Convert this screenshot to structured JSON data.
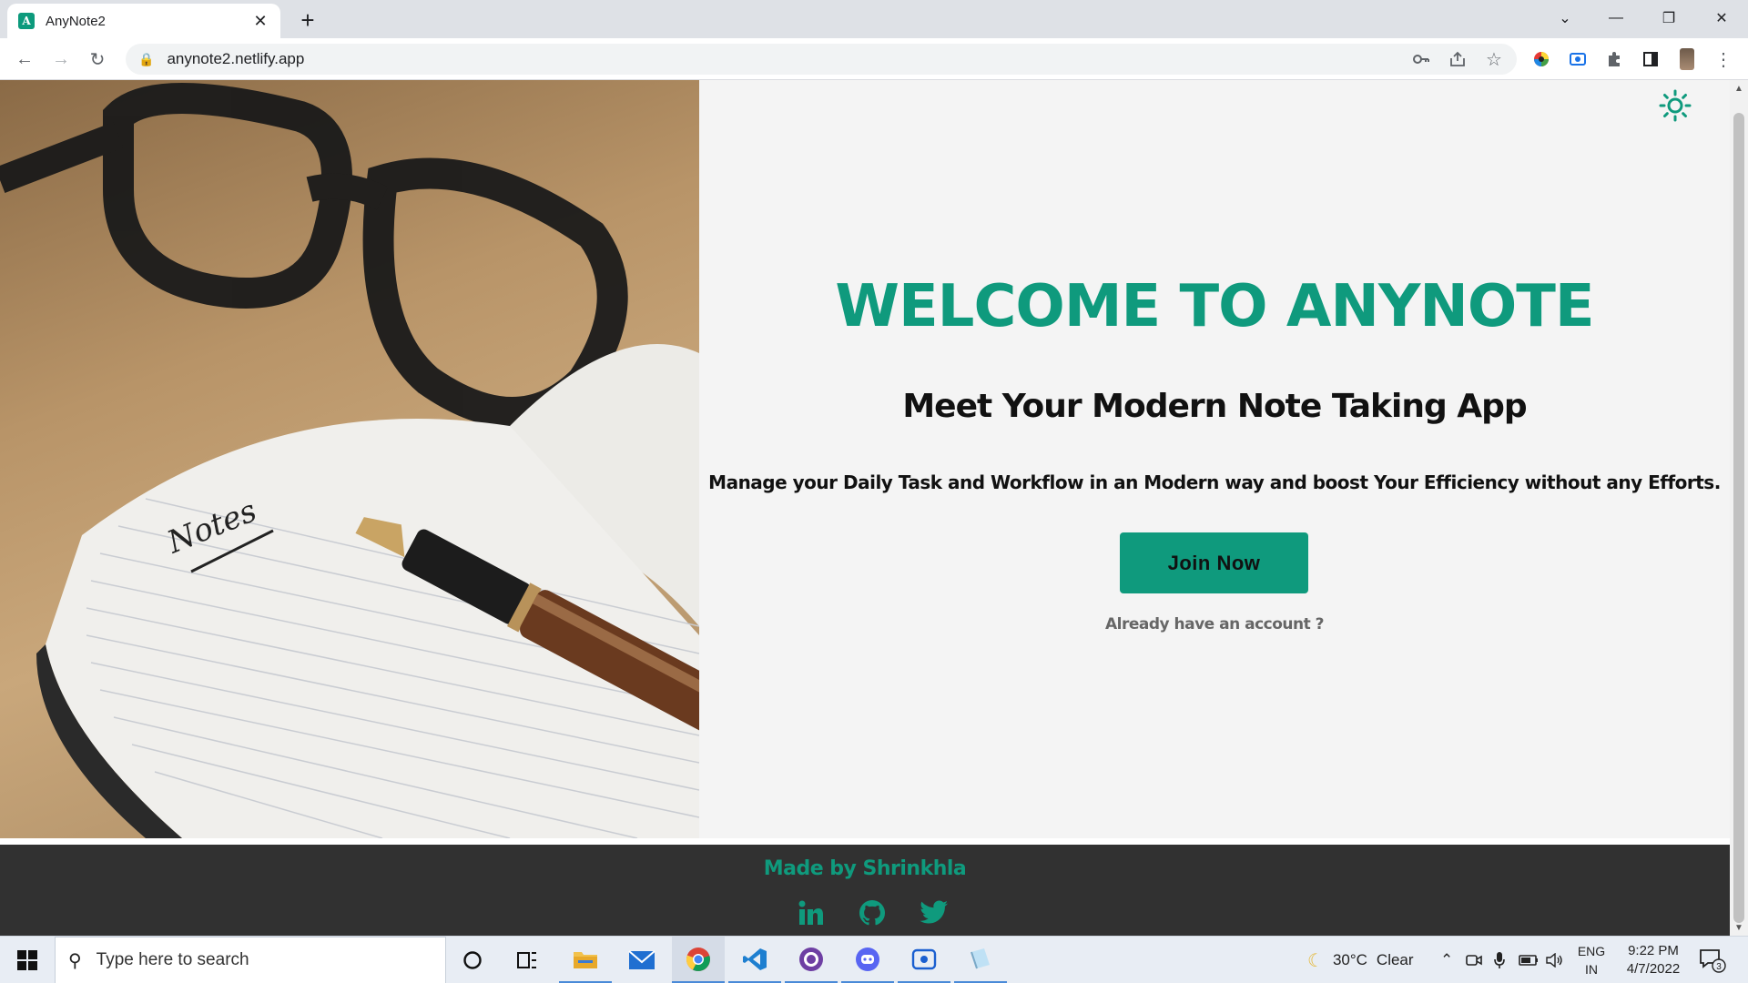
{
  "browser": {
    "tab_title": "AnyNote2",
    "favicon_letter": "A",
    "url": "anynote2.netlify.app"
  },
  "page": {
    "hero_title": "WELCOME TO ANYNOTE",
    "hero_subtitle": "Meet Your Modern Note Taking App",
    "hero_description": "Manage your Daily Task and Workflow in an Modern way and boost Your Efficiency without any Efforts.",
    "join_button": "Join Now",
    "login_link": "Already have an account ?",
    "image_note_text": "Notes",
    "footer_credit": "Made by Shrinkhla",
    "accent_color": "#0f9a7d"
  },
  "taskbar": {
    "search_placeholder": "Type here to search",
    "weather_temp": "30°C",
    "weather_desc": "Clear",
    "lang_line1": "ENG",
    "lang_line2": "IN",
    "time": "9:22 PM",
    "date": "4/7/2022",
    "notification_count": "3"
  }
}
